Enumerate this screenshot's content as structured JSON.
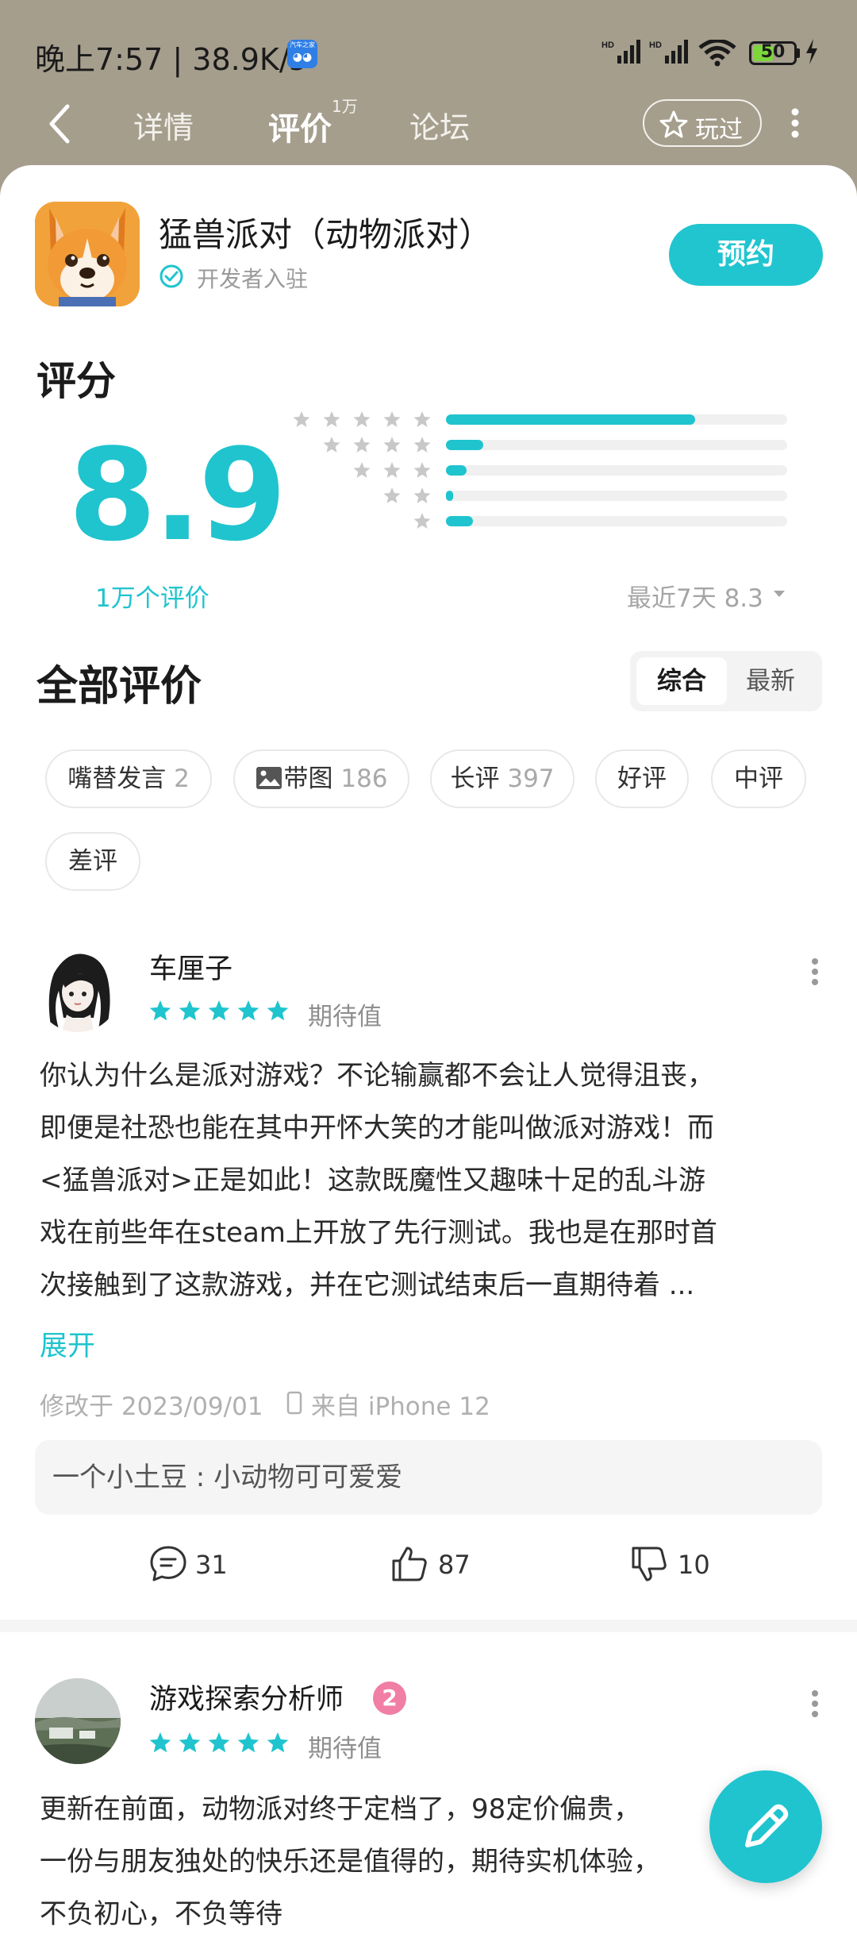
{
  "status_bar": {
    "time": "晚上7:57 | 38.9K/s",
    "carrier_badge": "汽车之家",
    "battery": "50",
    "battery_level": 0.5
  },
  "nav": {
    "tabs": [
      {
        "label": "详情"
      },
      {
        "label": "评价",
        "sup": "1万"
      },
      {
        "label": "论坛"
      }
    ],
    "played_label": "玩过"
  },
  "app": {
    "title": "猛兽派对（动物派对）",
    "dev_label": "开发者入驻",
    "reserve_label": "预约"
  },
  "rating": {
    "heading": "评分",
    "score": "8.9",
    "count_label": "1万个评价",
    "distribution": [
      {
        "stars": 5,
        "fraction": 0.73
      },
      {
        "stars": 4,
        "fraction": 0.11
      },
      {
        "stars": 3,
        "fraction": 0.06
      },
      {
        "stars": 2,
        "fraction": 0.02
      },
      {
        "stars": 1,
        "fraction": 0.08
      }
    ],
    "recent_label": "最近7天 8.3"
  },
  "reviews_section": {
    "heading": "全部评价",
    "sort_options": [
      "综合",
      "最新"
    ],
    "active_sort": "综合",
    "filters": [
      {
        "label": "嘴替发言",
        "count": "2"
      },
      {
        "label": "带图",
        "count": "186",
        "icon": "image-icon"
      },
      {
        "label": "长评",
        "count": "397"
      },
      {
        "label": "好评",
        "count": ""
      },
      {
        "label": "中评",
        "count": ""
      },
      {
        "label": "差评",
        "count": ""
      }
    ]
  },
  "reviews": [
    {
      "username": "车厘子",
      "stars": 5,
      "tag": "期待值",
      "lines": [
        "你认为什么是派对游戏？不论输赢都不会让人觉得沮丧，",
        "即便是社恐也能在其中开怀大笑的才能叫做派对游戏！而",
        "<猛兽派对>正是如此！这款既魔性又趣味十足的乱斗游",
        "戏在前些年在steam上开放了先行测试。我也是在那时首",
        "次接触到了这款游戏，并在它测试结束后一直期待着 ..."
      ],
      "expand_label": "展开",
      "modified": "修改于 2023/09/01",
      "device": "来自 iPhone 12",
      "reply": "一个小土豆 : 小动物可可爱爱",
      "comments": "31",
      "likes": "87",
      "dislikes": "10"
    },
    {
      "username": "游戏探索分析师",
      "level": "2",
      "stars": 5,
      "tag": "期待值",
      "lines": [
        "更新在前面，动物派对终于定档了，98定价偏贵，",
        "一份与朋友独处的快乐还是值得的，期待实机体验，",
        "不负初心，不负等待"
      ]
    }
  ],
  "colors": {
    "accent": "#1fc4ce",
    "header_bg": "#a59e8d",
    "star": "#1fc4ce",
    "level_badge": "#f07ea5"
  }
}
